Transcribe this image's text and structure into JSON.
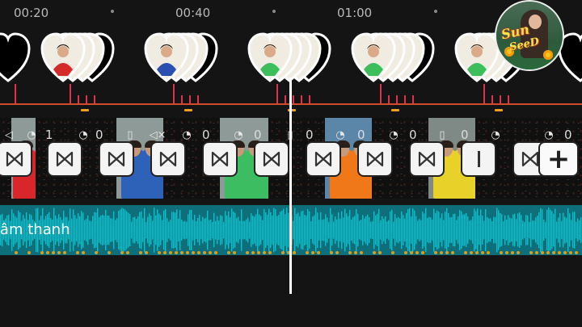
{
  "ruler": {
    "times": [
      "00:20",
      "00:40",
      "01:00"
    ]
  },
  "overlay": {
    "heart_groups": [
      {
        "photo": "none",
        "stack": 1
      },
      {
        "photo": "boy-red",
        "stack": 4
      },
      {
        "photo": "boy-blue",
        "stack": 4
      },
      {
        "photo": "girl-green",
        "stack": 5
      },
      {
        "photo": "girl-green",
        "stack": 5
      },
      {
        "photo": "girl-green",
        "stack": 4
      },
      {
        "photo": "none",
        "stack": 1
      }
    ]
  },
  "video": {
    "clip_counts": [
      "1",
      "0",
      "0",
      "0",
      "0",
      "0",
      "0",
      "0",
      "0",
      "0",
      "0",
      "0"
    ],
    "clip_icons": [
      "volume-icon",
      "speed-icon",
      "speed-icon",
      "vibrate-icon",
      "mute-icon",
      "speed-icon",
      "speed-icon",
      "vibrate-icon",
      "speed-icon",
      "speed-icon",
      "vibrate-icon",
      "speed-icon",
      "speed-icon"
    ],
    "transitions": [
      "bowtie",
      "bowtie",
      "bowtie",
      "bowtie",
      "bowtie",
      "bowtie",
      "bowtie",
      "bowtie",
      "bowtie",
      "bar",
      "bowtie"
    ],
    "add_label": "+"
  },
  "audio": {
    "label": "âm thanh",
    "color": "#0e6f7a"
  },
  "avatar": {
    "text_line1": "Sun",
    "text_line2": "SeeD"
  },
  "colors": {
    "accent_red": "#e0304a",
    "accent_orange": "#f0a020",
    "playhead": "#ffffff"
  }
}
